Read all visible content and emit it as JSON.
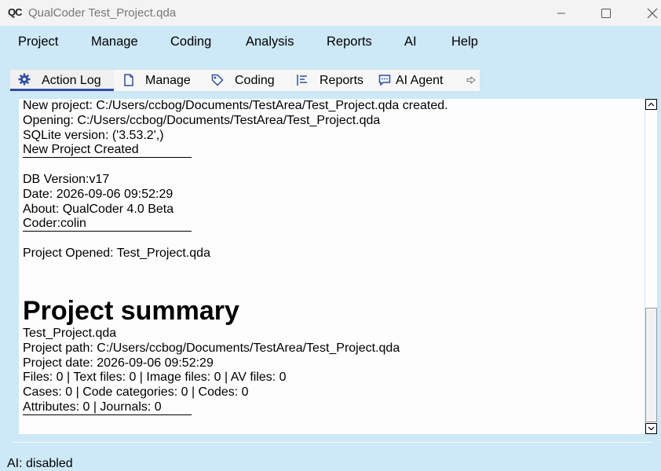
{
  "window": {
    "title": "QualCoder Test_Project.qda",
    "logo_text": "QC"
  },
  "menubar": {
    "items": [
      "Project",
      "Manage",
      "Coding",
      "Analysis",
      "Reports",
      "AI",
      "Help"
    ]
  },
  "toolbar": {
    "tabs": [
      {
        "label": "Action Log",
        "icon": "gear-icon",
        "active": true
      },
      {
        "label": "Manage",
        "icon": "document-icon",
        "active": false
      },
      {
        "label": "Coding",
        "icon": "tag-icon",
        "active": false
      },
      {
        "label": "Reports",
        "icon": "list-icon",
        "active": false
      },
      {
        "label": "AI Agent",
        "icon": "chat-icon",
        "active": false
      }
    ],
    "more_icon": "arrow-right-icon"
  },
  "log": {
    "lines": [
      "New project: C:/Users/ccbog/Documents/TestArea/Test_Project.qda created.",
      "Opening: C:/Users/ccbog/Documents/TestArea/Test_Project.qda",
      "SQLite version: ('3.53.2',)",
      "New Project Created",
      "DB Version:v17",
      "Date: 2026-09-06 09:52:29",
      "About: QualCoder 4.0 Beta",
      "Coder:colin",
      "Project Opened: Test_Project.qda"
    ]
  },
  "summary": {
    "heading": "Project summary",
    "lines": [
      "Test_Project.qda",
      "Project path: C:/Users/ccbog/Documents/TestArea/Test_Project.qda",
      "Project date: 2026-09-06 09:52:29",
      "Files: 0 | Text files: 0 | Image files: 0 | AV files: 0",
      "Cases: 0 | Code categories: 0 | Codes: 0",
      "Attributes: 0 | Journals: 0"
    ]
  },
  "status": {
    "text": "AI: disabled"
  }
}
